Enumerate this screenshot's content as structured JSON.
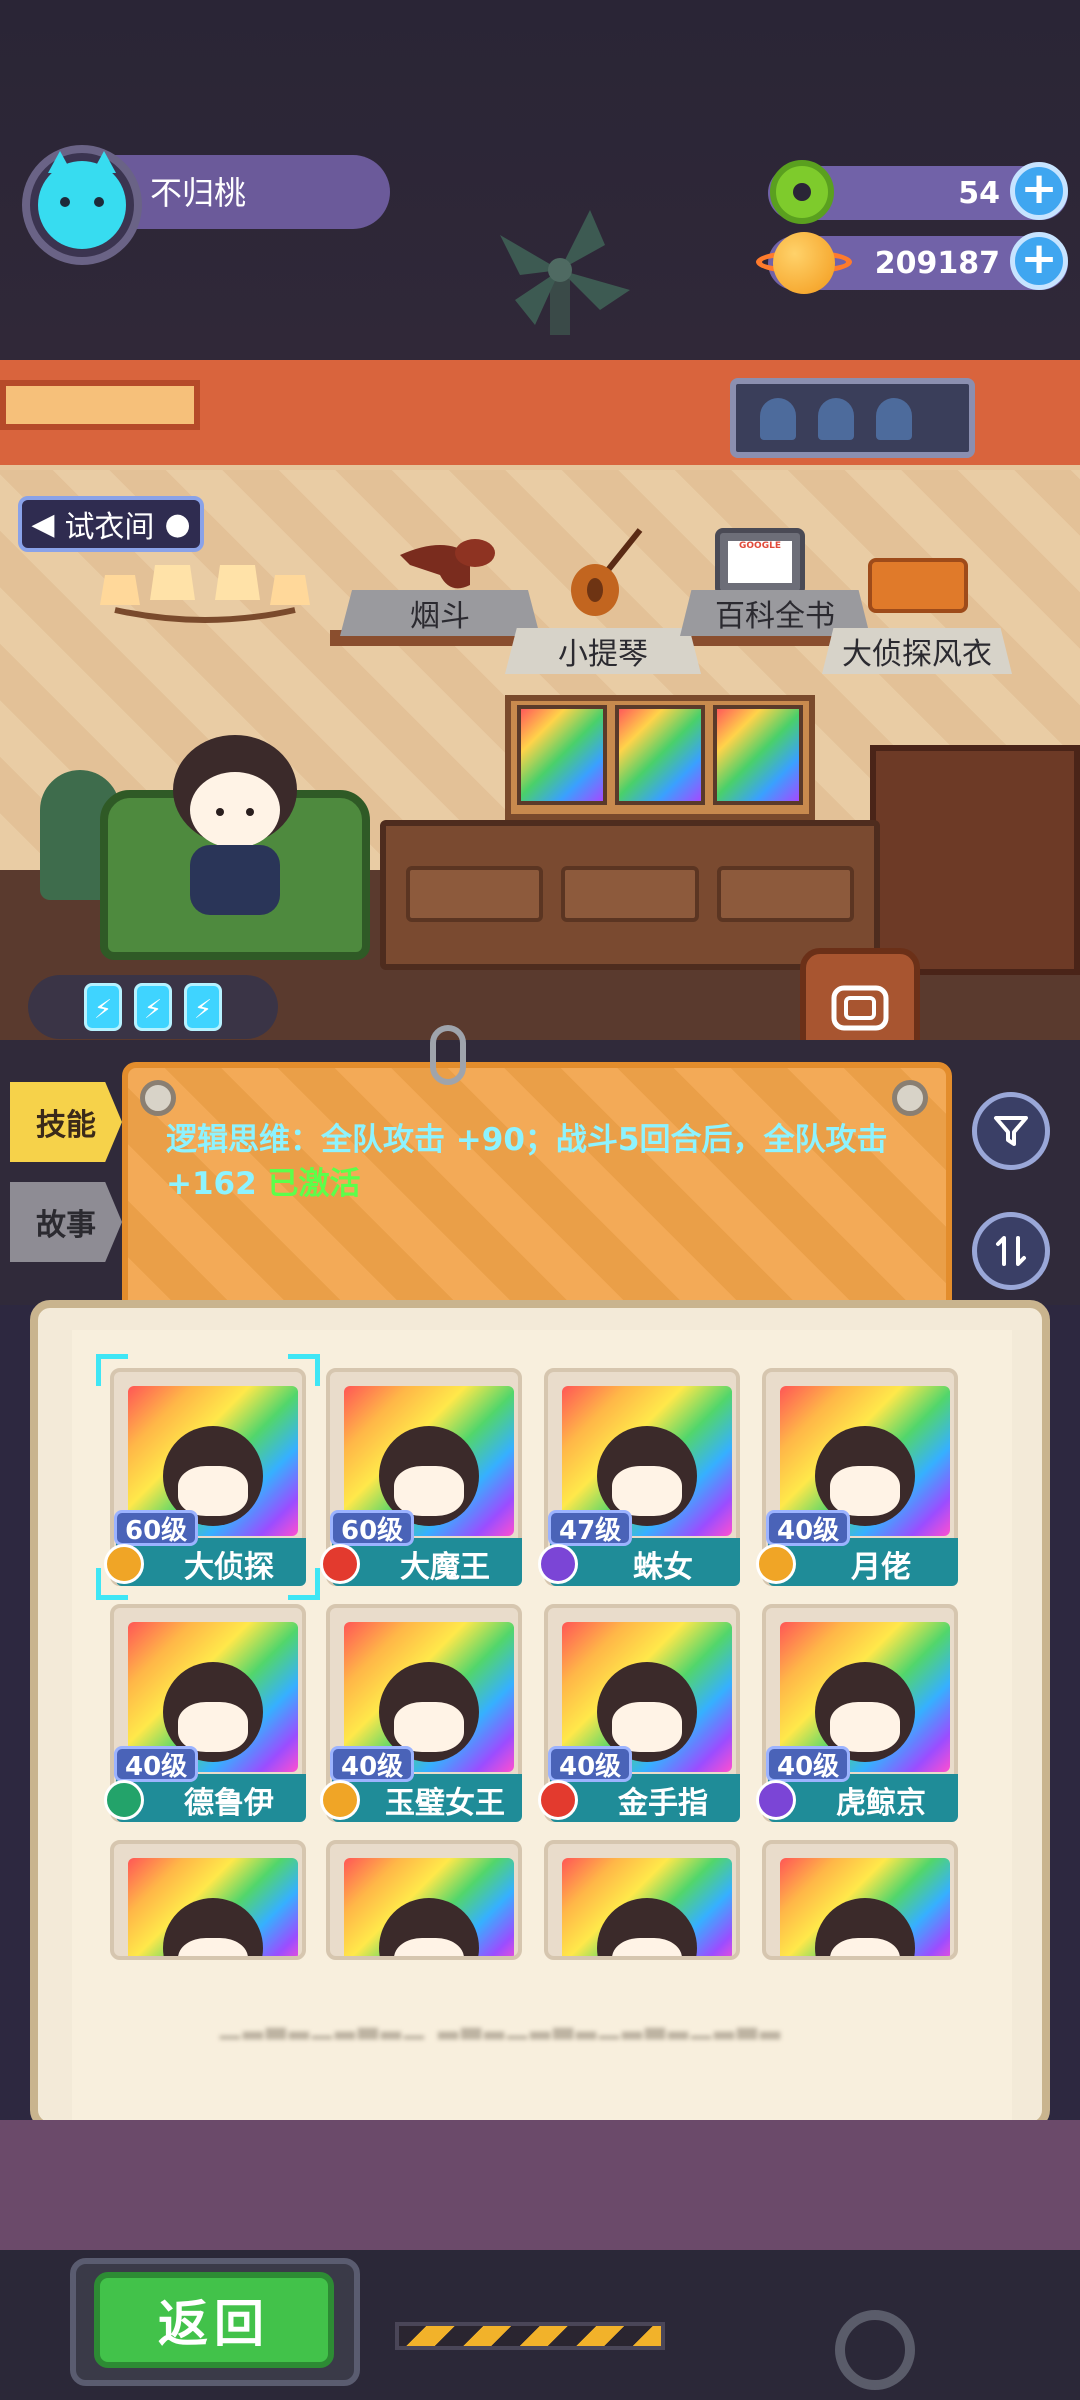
{
  "player": {
    "name": "不归桃"
  },
  "resources": [
    {
      "id": "donut",
      "value": "54"
    },
    {
      "id": "coin",
      "value": "209187"
    }
  ],
  "room": {
    "fitting_room_label": "试衣间",
    "items": [
      {
        "label": "烟斗"
      },
      {
        "label": "小提琴"
      },
      {
        "label": "百科全书"
      },
      {
        "label": "大侦探风衣"
      }
    ],
    "tablet_brand": "GOOGLE",
    "energy_count": 3
  },
  "tabs": {
    "skill": "技能",
    "story": "故事"
  },
  "skill": {
    "text": "逻辑思维：全队攻击 +90；战斗5回合后，全队攻击 +162",
    "status": "已激活"
  },
  "characters": [
    {
      "name": "大侦探",
      "level": "60级",
      "badge_color": "#f0a526",
      "selected": true
    },
    {
      "name": "大魔王",
      "level": "60级",
      "badge_color": "#e33a2e",
      "selected": false
    },
    {
      "name": "蛛女",
      "level": "47级",
      "badge_color": "#7b45d6",
      "selected": false
    },
    {
      "name": "月佬",
      "level": "40级",
      "badge_color": "#f0a526",
      "selected": false
    },
    {
      "name": "德鲁伊",
      "level": "40级",
      "badge_color": "#23a36a",
      "selected": false
    },
    {
      "name": "玉璧女王",
      "level": "40级",
      "badge_color": "#f0a526",
      "selected": false
    },
    {
      "name": "金手指",
      "level": "40级",
      "badge_color": "#e33a2e",
      "selected": false
    },
    {
      "name": "虎鲸京",
      "level": "40级",
      "badge_color": "#7b45d6",
      "selected": false
    }
  ],
  "partial_row_count": 4,
  "footer": {
    "back_label": "返回"
  },
  "colors": {
    "skill_text": "#8df3ff",
    "active_text": "#5cff4a",
    "nameplate": "#1f8c98",
    "back_button": "#42c24a"
  }
}
